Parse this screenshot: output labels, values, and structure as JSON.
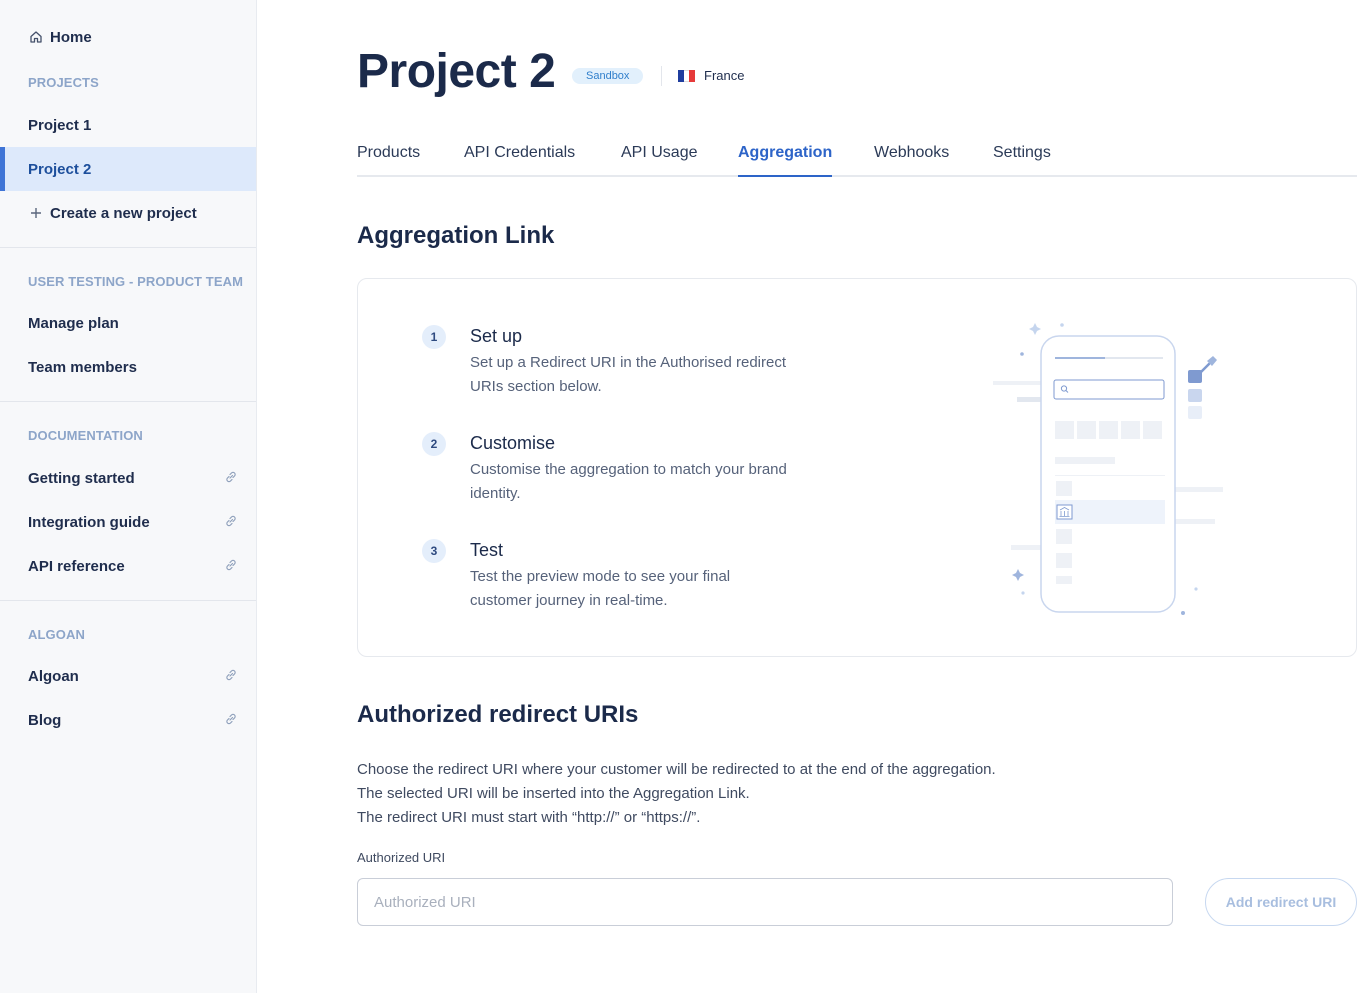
{
  "sidebar": {
    "home": "Home",
    "projects_label": "PROJECTS",
    "projects": [
      "Project 1",
      "Project 2"
    ],
    "create_project": "Create a new project",
    "team_label": "USER TESTING - PRODUCT TEAM",
    "manage_plan": "Manage plan",
    "team_members": "Team members",
    "docs_label": "DOCUMENTATION",
    "docs": [
      "Getting started",
      "Integration guide",
      "API reference"
    ],
    "algoan_label": "ALGOAN",
    "algoan_links": [
      "Algoan",
      "Blog"
    ]
  },
  "header": {
    "title": "Project 2",
    "badge": "Sandbox",
    "country": "France",
    "flag_colors": [
      "#1f3d9e",
      "#ffffff",
      "#e63a3a"
    ]
  },
  "tabs": [
    "Products",
    "API Credentials",
    "API Usage",
    "Aggregation",
    "Webhooks",
    "Settings"
  ],
  "active_tab": "Aggregation",
  "aggregation": {
    "heading": "Aggregation Link",
    "steps": [
      {
        "num": "1",
        "title": "Set up",
        "desc": "Set up a Redirect URI in the Authorised redirect URIs section below."
      },
      {
        "num": "2",
        "title": "Customise",
        "desc": "Customise the aggregation to match your brand identity."
      },
      {
        "num": "3",
        "title": "Test",
        "desc": "Test the preview mode to see your final customer journey in real-time."
      }
    ]
  },
  "redirect": {
    "heading": "Authorized redirect URIs",
    "desc_lines": [
      "Choose the redirect URI where your customer will be redirected to at the end of the aggregation.",
      "The selected URI will be inserted into the Aggregation Link.",
      "The redirect URI must start with “http://” or “https://”."
    ],
    "field_label": "Authorized URI",
    "placeholder": "Authorized URI",
    "value": "",
    "add_button": "Add redirect URI"
  },
  "colors": {
    "accent": "#2d64c8",
    "active_bg": "#dde9fb",
    "badge_bg": "#e2f0fc"
  }
}
